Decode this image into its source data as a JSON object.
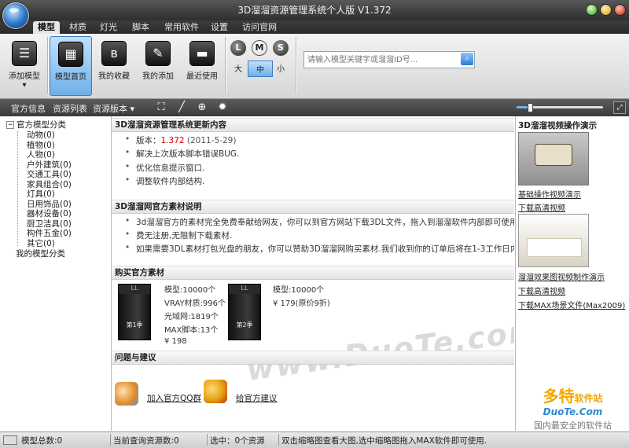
{
  "window": {
    "title": "3D溜溜资源管理系统个人版 V1.372"
  },
  "tabs": [
    "模型",
    "材质",
    "灯光",
    "脚本",
    "常用软件",
    "设置",
    "访问官网"
  ],
  "ribbon": {
    "buttons": [
      {
        "label": "添加模型",
        "icon": "rss-icon"
      },
      {
        "label": "模型首页",
        "icon": "folder-home-icon"
      },
      {
        "label": "我的收藏",
        "icon": "bluetooth-icon"
      },
      {
        "label": "我的添加",
        "icon": "wrench-icon"
      },
      {
        "label": "最近使用",
        "icon": "drive-icon"
      }
    ],
    "sizes": [
      {
        "letter": "L",
        "label": "大"
      },
      {
        "letter": "M",
        "label": "中"
      },
      {
        "letter": "S",
        "label": "小"
      }
    ],
    "search_placeholder": "请输入模型关键字或溜溜ID号..."
  },
  "toolbar2": {
    "items": [
      "官方信息",
      "资源列表",
      "资源版本 ▾"
    ],
    "zoom_fraction": 0.15
  },
  "tree": {
    "root": "官方模型分类",
    "children": [
      "动物(0)",
      "植物(0)",
      "人物(0)",
      "户外建筑(0)",
      "交通工具(0)",
      "家具组合(0)",
      "灯具(0)",
      "日用饰品(0)",
      "器材设备(0)",
      "厨卫洁具(0)",
      "构件五金(0)",
      "其它(0)"
    ],
    "root2": "我的模型分类"
  },
  "center": {
    "update_title": "3D溜溜资源管理系统更新内容",
    "version_prefix": "版本：",
    "version": "1.372",
    "version_date": "(2011-5-29)",
    "updates": [
      "解决上次版本脚本错误BUG.",
      "优化信息提示窗口.",
      "调整软件内部结构."
    ],
    "material_title": "3D溜溜网官方素材说明",
    "material_line1": "3d溜溜官方的素材完全免费奉献给网友，你可以到官方网站下载3DL文件，拖入到溜溜软件内部即可使用。可以免",
    "material_line2": "费无注册,无限制下载素材.",
    "material_line3": "如果需要3DL素材打包光盘的朋友，你可以赞助3D溜溜网购买素材.我们收到你的订单后将在1-3工作日内发货.",
    "watermark": "www.DuoTe.com",
    "buy_title": "购买官方素材",
    "box_brand": "LL",
    "box1": {
      "season": "第1季",
      "specs": [
        "模型:10000个",
        "VRAY材质:996个",
        "光域网:1819个",
        "MAX脚本:13个"
      ],
      "price": "¥ 198"
    },
    "box2": {
      "season": "第2季",
      "specs": [
        "模型:10000个"
      ],
      "price": "¥ 179(原价9折)"
    },
    "feedback_title": "问题与建议",
    "qq_link": "加入官方QQ群",
    "suggest_link": "给官方建议"
  },
  "right": {
    "title": "3D溜溜视频操作演示",
    "links": [
      "基础操作视频演示",
      "下载高清视频",
      "溜溜效果图视频制作演示",
      "下载高清视频",
      "下载MAX场景文件(Max2009)"
    ],
    "wm_brand": "多特",
    "wm_suffix": "软件站",
    "wm_url": "DuoTe.Com",
    "wm_slogan": "国内最安全的软件站"
  },
  "status": {
    "total": "模型总数:0",
    "query": "当前查询资源数:0",
    "selected": "选中：0个资源",
    "hint": "双击缩略图查看大图,选中缩略图拖入MAX软件即可使用."
  }
}
